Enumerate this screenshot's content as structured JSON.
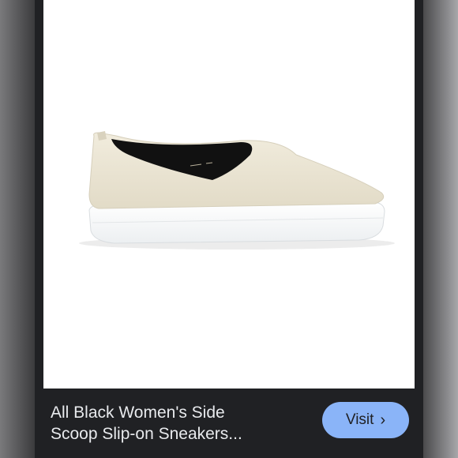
{
  "result": {
    "title_line1": "All Black Women's Side",
    "title_line2": "Scoop Slip-on Sneakers...",
    "visit_label": "Visit",
    "visit_chevron": "›",
    "source_text": "",
    "image_alt": "Cream leather slip-on sneaker with white sole",
    "icons": {
      "visit": "chevron-right-icon"
    }
  },
  "colors": {
    "background": "#202124",
    "title_text": "#e8eaed",
    "button": "#8ab4f8",
    "button_text": "#202124",
    "shoe_upper": "#ebe5d4",
    "sole": "#ffffff"
  }
}
